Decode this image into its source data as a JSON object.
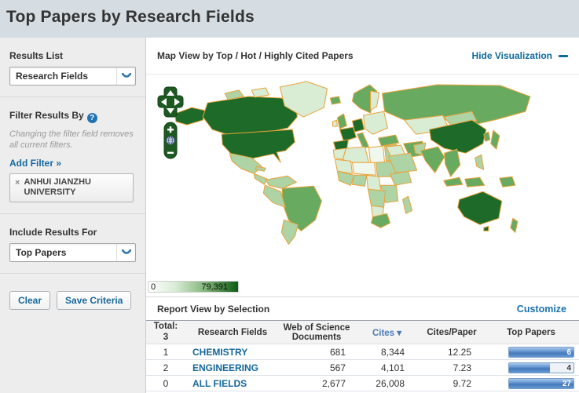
{
  "page": {
    "title": "Top Papers by Research Fields"
  },
  "sidebar": {
    "results_list": {
      "label": "Results List",
      "value": "Research Fields"
    },
    "filter": {
      "label": "Filter Results By",
      "help_glyph": "?",
      "note": "Changing the filter field removes all current filters.",
      "add_filter_label": "Add Filter »",
      "tag": {
        "remove_glyph": "×",
        "label": "ANHUI JIANZHU UNIVERSITY"
      }
    },
    "include_results": {
      "label": "Include Results For",
      "value": "Top Papers"
    },
    "actions": {
      "clear_label": "Clear",
      "save_label": "Save Criteria"
    }
  },
  "visualization": {
    "title": "Map View by Top / Hot / Highly Cited Papers",
    "hide_label": "Hide Visualization",
    "legend": {
      "min": "0",
      "max": "79,391"
    },
    "controls": {
      "zoom_in_glyph": "+",
      "zoom_out_glyph": "−"
    }
  },
  "report": {
    "title": "Report View by Selection",
    "customize_label": "Customize",
    "header": {
      "total_label": "Total:",
      "total_value": "3",
      "research_fields": "Research Fields",
      "documents": "Web of Science Documents",
      "cites": "Cites",
      "sort_glyph": "▾",
      "cites_per_paper": "Cites/Paper",
      "top_papers": "Top Papers"
    },
    "rows": [
      {
        "count": "1",
        "field": "CHEMISTRY",
        "documents": "681",
        "cites": "8,344",
        "cites_per_paper": "12.25",
        "top_papers": "6",
        "bar_pct": 100
      },
      {
        "count": "2",
        "field": "ENGINEERING",
        "documents": "567",
        "cites": "4,101",
        "cites_per_paper": "7.23",
        "top_papers": "4",
        "bar_pct": 63
      },
      {
        "count": "0",
        "field": "ALL FIELDS",
        "documents": "2,677",
        "cites": "26,008",
        "cites_per_paper": "9.72",
        "top_papers": "27",
        "bar_pct": 100
      }
    ]
  },
  "colors": {
    "header_bg": "#d5dce2",
    "link_blue": "#15689c",
    "map_border_orange": "#e9a23b",
    "map_green_dark": "#1e6b29",
    "map_green_medium": "#67aa60",
    "map_green_light": "#aed3a4",
    "bar_fill_blue": "#4678ba",
    "legend_max_green": "#0b5a12"
  }
}
